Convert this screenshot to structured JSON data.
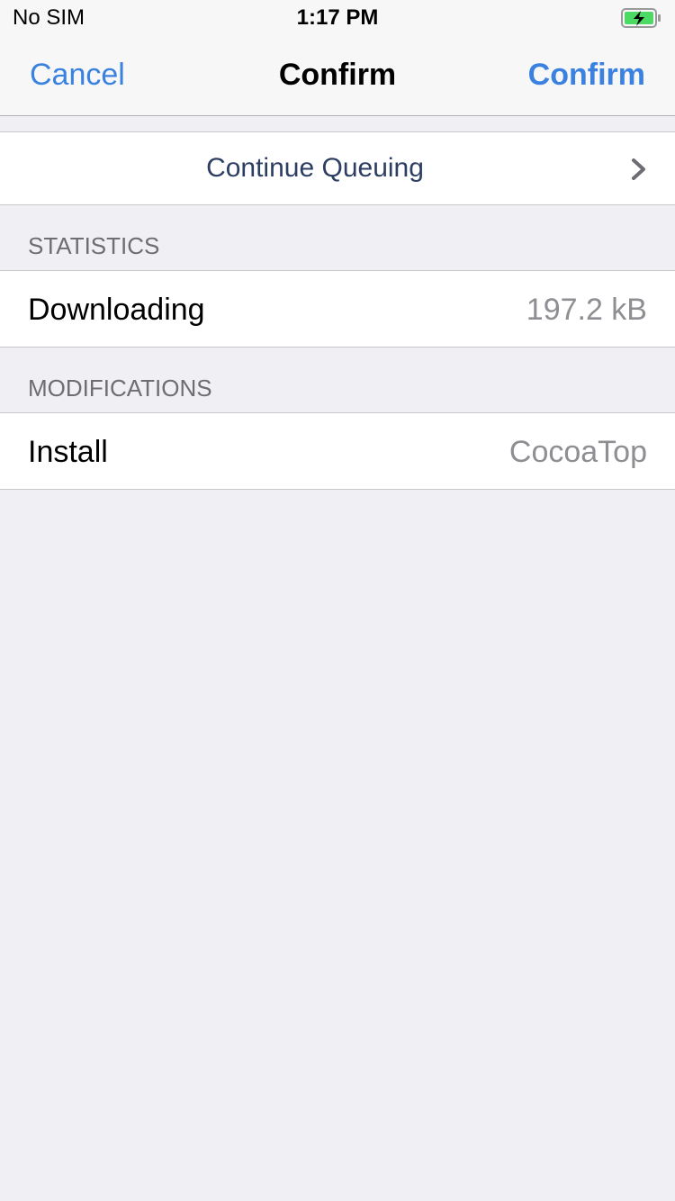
{
  "status_bar": {
    "carrier": "No SIM",
    "time": "1:17 PM",
    "battery_icon": "battery-charging-icon",
    "battery_color": "#4cd964"
  },
  "nav": {
    "cancel_label": "Cancel",
    "title": "Confirm",
    "confirm_label": "Confirm",
    "accent_color": "#3b82e0"
  },
  "queue": {
    "label": "Continue Queuing",
    "icon": "chevron-right-icon"
  },
  "sections": {
    "statistics": {
      "header": "STATISTICS",
      "row_label": "Downloading",
      "row_value": "197.2 kB"
    },
    "modifications": {
      "header": "MODIFICATIONS",
      "row_label": "Install",
      "row_value": "CocoaTop"
    }
  }
}
